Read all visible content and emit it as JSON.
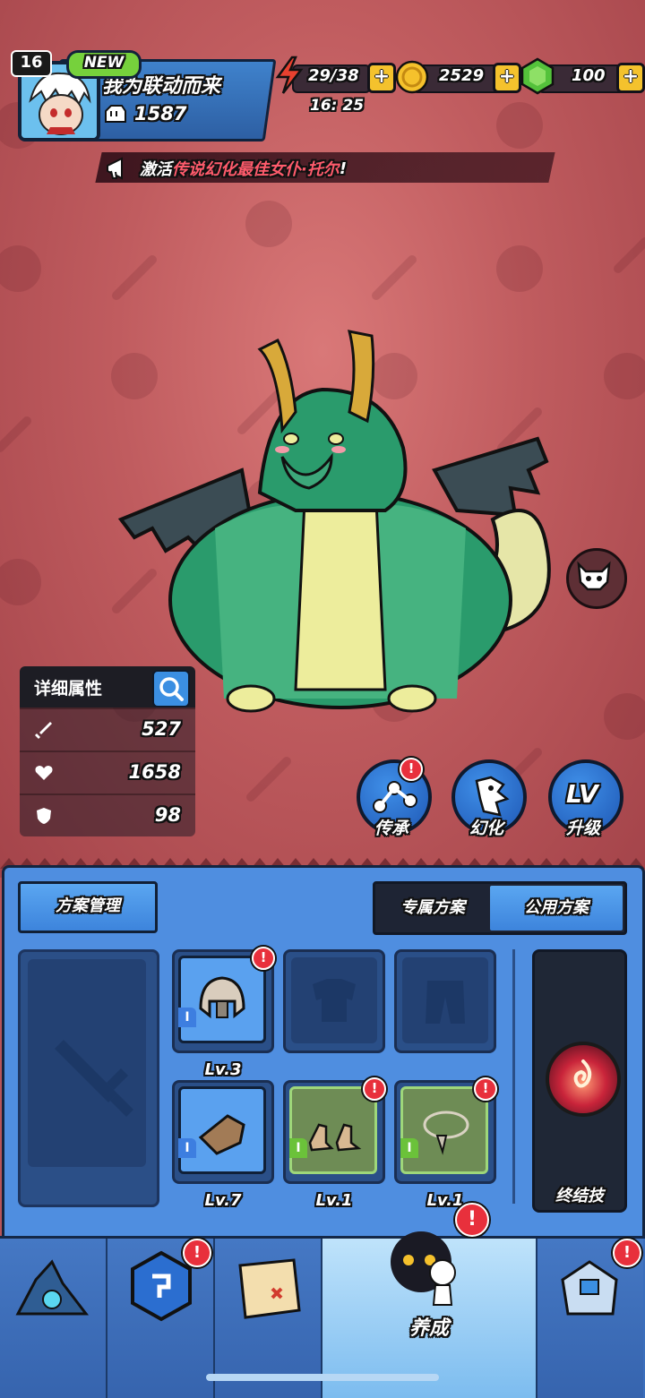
{
  "player": {
    "level": "16",
    "new_badge": "NEW",
    "name": "我为联动而来",
    "power": "1587"
  },
  "resources": {
    "stamina": "29/38",
    "stamina_timer": "16: 25",
    "gold": "2529",
    "gems": "100",
    "plus": "+"
  },
  "announcement": {
    "prefix": "激活",
    "highlight": "传说幻化最佳女仆·托尔",
    "suffix": "!"
  },
  "stats": {
    "title": "详细属性",
    "attack": "527",
    "hp": "1658",
    "defense": "98"
  },
  "actions": {
    "inherit": "传承",
    "transform": "幻化",
    "upgrade": "升级",
    "upgrade_icon": "LV"
  },
  "loadout": {
    "manage_button": "方案管理",
    "exclusive_tab": "专属方案",
    "public_tab": "公用方案",
    "helmet_level": "Lv.3",
    "gloves_level": "Lv.7",
    "boots_level": "Lv.1",
    "necklace_level": "Lv.1",
    "tier": "I",
    "ultimate_label": "终结技"
  },
  "nav": {
    "active_label": "养成"
  },
  "alert_mark": "!",
  "colors": {
    "primary_blue": "#4f8ee0",
    "alert_red": "#e8303c",
    "highlight_red": "#ff5b6c",
    "accent_green": "#76d13c",
    "gold": "#f4c22d"
  }
}
